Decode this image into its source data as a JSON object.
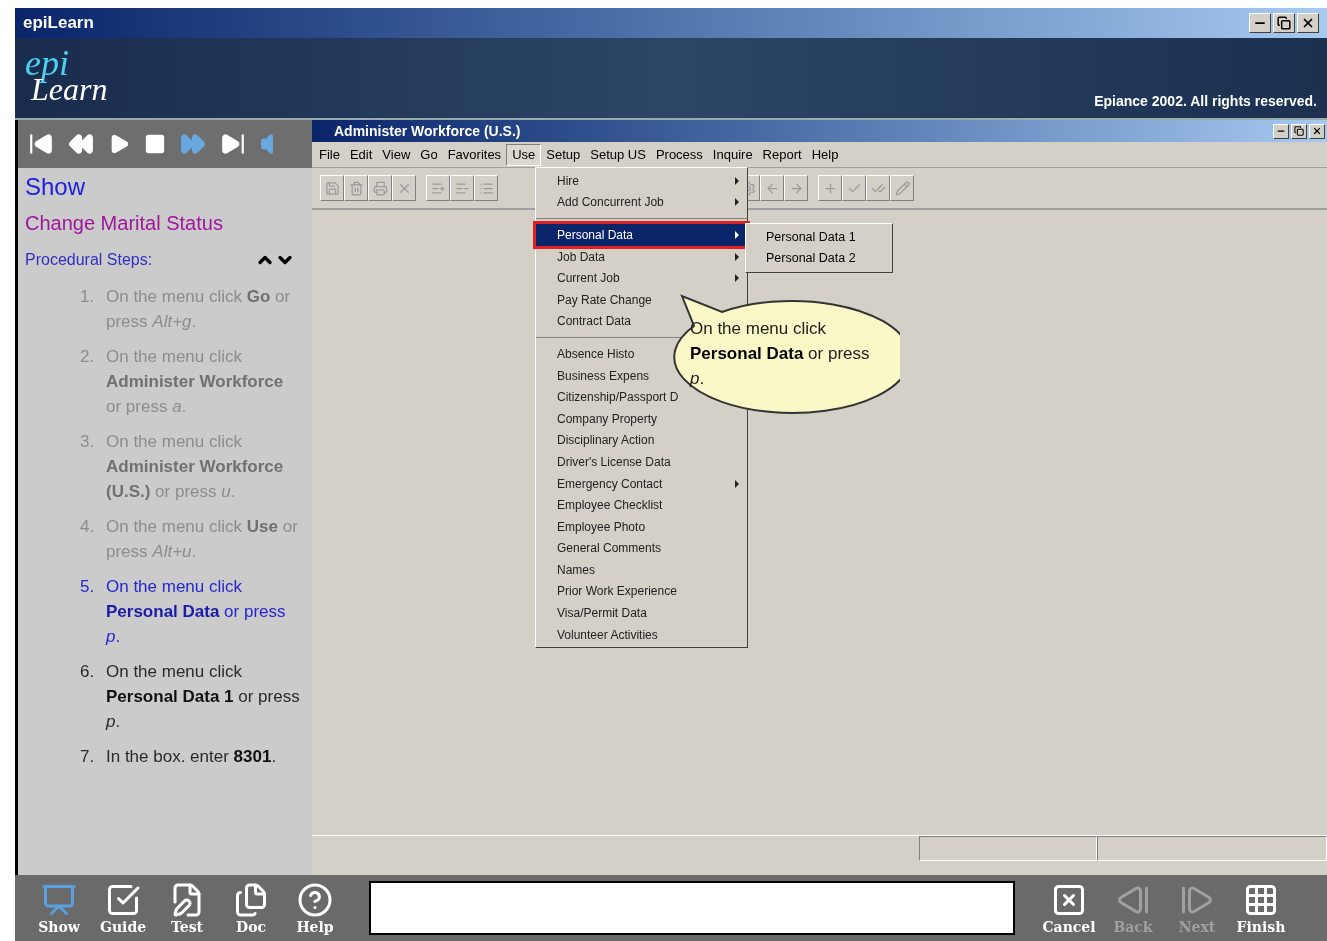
{
  "window": {
    "title": "epiLearn"
  },
  "banner": {
    "logo_top": "epi",
    "logo_bottom": "Learn",
    "copyright": "Epiance 2002. All rights reserved."
  },
  "guide": {
    "mode": "Show",
    "task": "Change Marital Status",
    "steps_heading": "Procedural Steps:",
    "steps": [
      {
        "number": "1.",
        "text": "On the menu click **Go** or press *Alt+g*.",
        "completed": true,
        "selected": false
      },
      {
        "number": "2.",
        "text": "On the menu click **Administer Workforce** or press *a*.",
        "completed": true,
        "selected": false
      },
      {
        "number": "3.",
        "text": "On the menu click **Administer Workforce (U.S.)** or press *u*.",
        "completed": true,
        "selected": false
      },
      {
        "number": "4.",
        "text": "On the menu click **Use** or press *Alt+u*.",
        "completed": true,
        "selected": false
      },
      {
        "number": "5.",
        "text": "On the menu click **Personal Data** or press *p*.",
        "completed": false,
        "selected": true
      },
      {
        "number": "6.",
        "text": "On the menu click **Personal Data 1** or press *p*.",
        "completed": false,
        "selected": false
      },
      {
        "number": "7.",
        "text": "In the  box. enter **8301**.",
        "completed": false,
        "selected": false
      }
    ]
  },
  "app": {
    "title": "Administer Workforce (U.S.)",
    "menu_bar": [
      {
        "label": "File",
        "selected": false
      },
      {
        "label": "Edit",
        "selected": false
      },
      {
        "label": "View",
        "selected": false
      },
      {
        "label": "Go",
        "selected": false
      },
      {
        "label": "Favorites",
        "selected": false
      },
      {
        "label": "Use",
        "selected": true
      },
      {
        "label": "Setup",
        "selected": false
      },
      {
        "label": "Setup US",
        "selected": false
      },
      {
        "label": "Process",
        "selected": false
      },
      {
        "label": "Inquire",
        "selected": false
      },
      {
        "label": "Report",
        "selected": false
      },
      {
        "label": "Help",
        "selected": false
      }
    ],
    "menu_groups": [
      [
        {
          "label": "Hire",
          "submenu": true,
          "selected": false
        },
        {
          "label": "Add Concurrent Job",
          "submenu": true,
          "selected": false
        }
      ],
      [
        {
          "label": "Personal Data",
          "submenu": true,
          "selected": true
        },
        {
          "label": "Job Data",
          "submenu": true,
          "selected": false
        },
        {
          "label": "Current Job",
          "submenu": true,
          "selected": false
        },
        {
          "label": "Pay Rate Change",
          "submenu": false,
          "selected": false
        },
        {
          "label": "Contract Data",
          "selected": false
        }
      ],
      [
        {
          "label": "Absence Histo",
          "selected": false
        },
        {
          "label": "Business Expens",
          "selected": false
        },
        {
          "label": "Citizenship/Passport D",
          "selected": false
        },
        {
          "label": "Company Property",
          "submenu": false,
          "selected": false
        },
        {
          "label": "Disciplinary Action",
          "submenu": false,
          "selected": false
        },
        {
          "label": "Driver's License Data",
          "submenu": false,
          "selected": false
        },
        {
          "label": "Emergency Contact",
          "submenu": true,
          "selected": false
        },
        {
          "label": "Employee Checklist",
          "submenu": false,
          "selected": false
        },
        {
          "label": "Employee Photo",
          "submenu": false,
          "selected": false
        },
        {
          "label": "General Comments",
          "submenu": false,
          "selected": false
        },
        {
          "label": "Names",
          "submenu": false,
          "selected": false
        },
        {
          "label": "Prior Work Experience",
          "submenu": false,
          "selected": false
        },
        {
          "label": "Visa/Permit Data",
          "submenu": false,
          "selected": false
        },
        {
          "label": "Volunteer Activities",
          "submenu": false,
          "selected": false
        }
      ]
    ],
    "submenu": [
      "Personal Data 1",
      "Personal Data 2"
    ],
    "callout": "On the menu click **Personal Data** or press *p*."
  },
  "bottom_bar": {
    "left": [
      {
        "label": "Show",
        "kind": "show",
        "disabled": false
      },
      {
        "label": "Guide",
        "kind": "guide",
        "disabled": false
      },
      {
        "label": "Test",
        "kind": "test",
        "disabled": false
      },
      {
        "label": "Doc",
        "kind": "doc",
        "disabled": false
      },
      {
        "label": "Help",
        "kind": "help",
        "disabled": false
      }
    ],
    "right": [
      {
        "label": "Cancel",
        "kind": "cancel",
        "disabled": false
      },
      {
        "label": "Back",
        "kind": "back",
        "disabled": true
      },
      {
        "label": "Next",
        "kind": "next",
        "disabled": true
      },
      {
        "label": "Finish",
        "kind": "finish",
        "disabled": false
      }
    ]
  }
}
